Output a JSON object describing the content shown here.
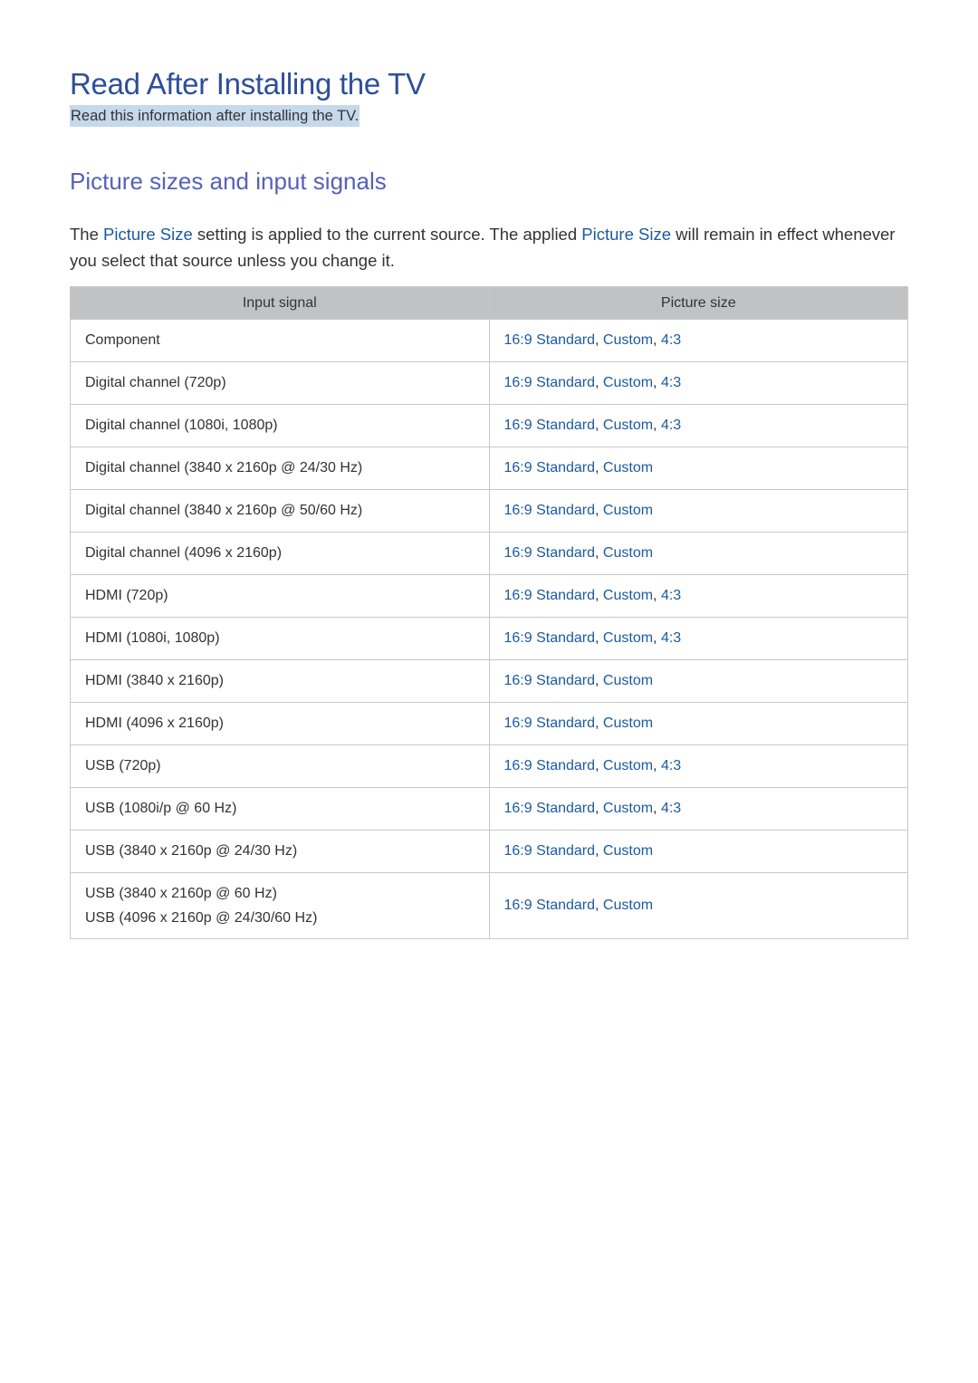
{
  "header": {
    "title": "Read After Installing the TV",
    "subtitle": "Read this information after installing the TV."
  },
  "section": {
    "title": "Picture sizes and input signals",
    "intro": {
      "part1": "The ",
      "keyword1": "Picture Size",
      "part2": " setting is applied to the current source. The applied ",
      "keyword2": "Picture Size",
      "part3": " will remain in effect whenever you select that source unless you change it."
    }
  },
  "colors": {
    "title": "#2d4f9a",
    "section_title": "#5661b9",
    "keyword": "#1c5aa0",
    "highlight": "#c5d8ec",
    "table_header_bg": "#c1c2c3"
  },
  "table": {
    "headers": [
      "Input signal",
      "Picture size"
    ],
    "rows": [
      {
        "signal": [
          "Component"
        ],
        "sizes": [
          "16:9 Standard",
          "Custom",
          "4:3"
        ]
      },
      {
        "signal": [
          "Digital channel (720p)"
        ],
        "sizes": [
          "16:9 Standard",
          "Custom",
          "4:3"
        ]
      },
      {
        "signal": [
          "Digital channel (1080i, 1080p)"
        ],
        "sizes": [
          "16:9 Standard",
          "Custom",
          "4:3"
        ]
      },
      {
        "signal": [
          "Digital channel (3840 x 2160p @ 24/30 Hz)"
        ],
        "sizes": [
          "16:9 Standard",
          "Custom"
        ]
      },
      {
        "signal": [
          "Digital channel (3840 x 2160p @ 50/60 Hz)"
        ],
        "sizes": [
          "16:9 Standard",
          "Custom"
        ]
      },
      {
        "signal": [
          "Digital channel (4096 x 2160p)"
        ],
        "sizes": [
          "16:9 Standard",
          "Custom"
        ]
      },
      {
        "signal": [
          "HDMI (720p)"
        ],
        "sizes": [
          "16:9 Standard",
          "Custom",
          "4:3"
        ]
      },
      {
        "signal": [
          "HDMI (1080i, 1080p)"
        ],
        "sizes": [
          "16:9 Standard",
          "Custom",
          "4:3"
        ]
      },
      {
        "signal": [
          "HDMI (3840 x 2160p)"
        ],
        "sizes": [
          "16:9 Standard",
          "Custom"
        ]
      },
      {
        "signal": [
          "HDMI (4096 x 2160p)"
        ],
        "sizes": [
          "16:9 Standard",
          "Custom"
        ]
      },
      {
        "signal": [
          "USB (720p)"
        ],
        "sizes": [
          "16:9 Standard",
          "Custom",
          "4:3"
        ]
      },
      {
        "signal": [
          "USB (1080i/p @ 60 Hz)"
        ],
        "sizes": [
          "16:9 Standard",
          "Custom",
          "4:3"
        ]
      },
      {
        "signal": [
          "USB (3840 x 2160p @ 24/30 Hz)"
        ],
        "sizes": [
          "16:9 Standard",
          "Custom"
        ]
      },
      {
        "signal": [
          "USB (3840 x 2160p @ 60 Hz)",
          "USB (4096 x 2160p @ 24/30/60 Hz)"
        ],
        "sizes": [
          "16:9 Standard",
          "Custom"
        ]
      }
    ]
  }
}
